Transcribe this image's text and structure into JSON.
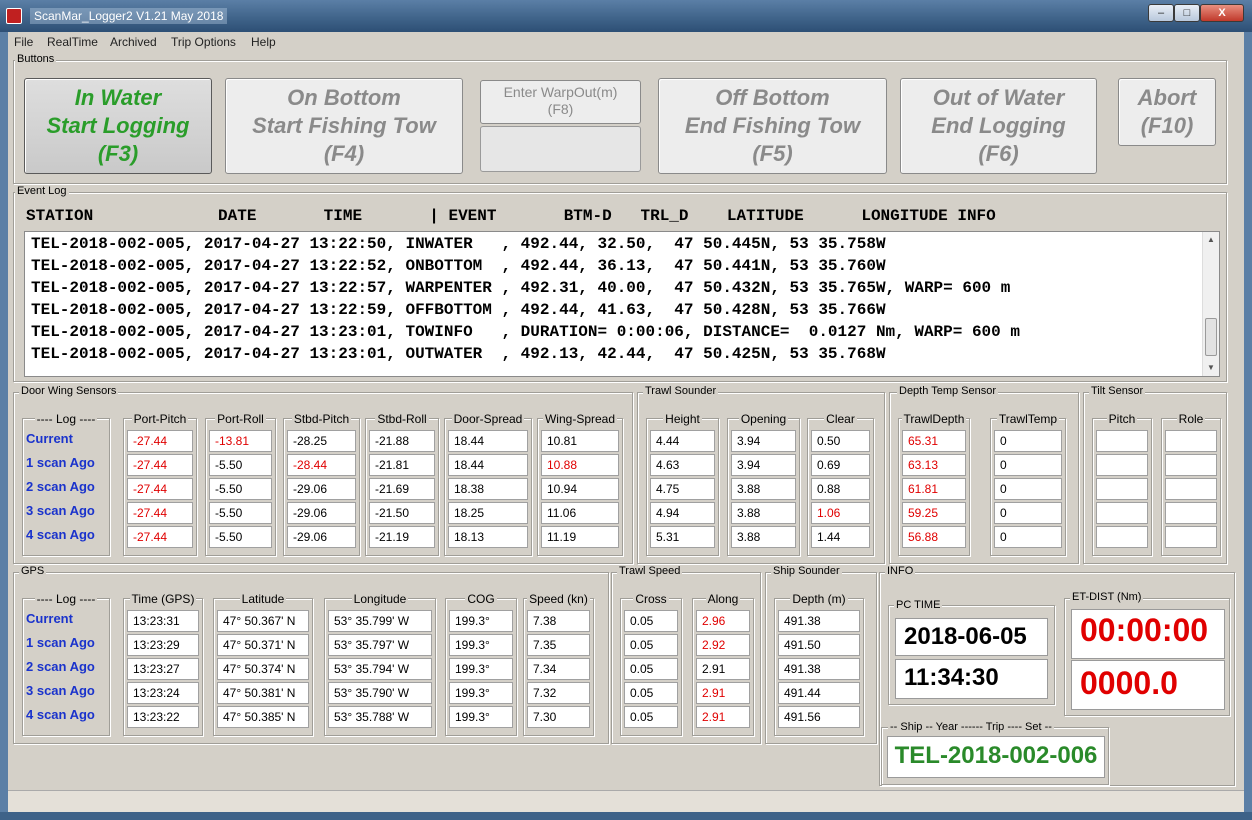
{
  "window": {
    "title": "ScanMar_Logger2 V1.21 May 2018",
    "minimize": "–",
    "maximize": "□",
    "close": "X"
  },
  "menu": [
    "File",
    "RealTime",
    "Archived",
    "Trip Options",
    "Help"
  ],
  "buttons_group": {
    "label": "Buttons",
    "in_water": [
      "In Water",
      "Start Logging",
      "(F3)"
    ],
    "on_bottom": [
      "On Bottom",
      "Start Fishing Tow",
      "(F4)"
    ],
    "warp": [
      "Enter WarpOut(m)",
      "(F8)"
    ],
    "off_bottom": [
      "Off Bottom",
      "End Fishing Tow",
      "(F5)"
    ],
    "out_of_water": [
      "Out of Water",
      "End Logging",
      "(F6)"
    ],
    "abort": [
      "Abort",
      "(F10)"
    ]
  },
  "event_log": {
    "label": "Event Log",
    "header": "STATION             DATE       TIME       | EVENT       BTM-D   TRL_D    LATITUDE      LONGITUDE INFO",
    "rows": [
      "TEL-2018-002-005, 2017-04-27 13:22:50, INWATER   , 492.44, 32.50,  47 50.445N, 53 35.758W",
      "TEL-2018-002-005, 2017-04-27 13:22:52, ONBOTTOM  , 492.44, 36.13,  47 50.441N, 53 35.760W",
      "TEL-2018-002-005, 2017-04-27 13:22:57, WARPENTER , 492.31, 40.00,  47 50.432N, 53 35.765W, WARP= 600 m",
      "TEL-2018-002-005, 2017-04-27 13:22:59, OFFBOTTOM , 492.44, 41.63,  47 50.428N, 53 35.766W",
      "TEL-2018-002-005, 2017-04-27 13:23:01, TOWINFO   , DURATION= 0:00:06, DISTANCE=  0.0127 Nm, WARP= 600 m",
      "TEL-2018-002-005, 2017-04-27 13:23:01, OUTWATER  , 492.13, 42.44,  47 50.425N, 53 35.768W"
    ]
  },
  "log_labels": {
    "header": "---- Log ----",
    "rows": [
      "Current",
      "1 scan Ago",
      "2 scan Ago",
      "3 scan Ago",
      "4 scan Ago"
    ]
  },
  "door_wing": {
    "label": "Door  Wing Sensors",
    "columns": [
      {
        "title": "Port-Pitch",
        "values": [
          "-27.44",
          "-27.44",
          "-27.44",
          "-27.44",
          "-27.44"
        ],
        "red": [
          true,
          true,
          true,
          true,
          true
        ]
      },
      {
        "title": "Port-Roll",
        "values": [
          "-13.81",
          "-5.50",
          "-5.50",
          "-5.50",
          "-5.50"
        ],
        "red": [
          true,
          false,
          false,
          false,
          false
        ]
      },
      {
        "title": "Stbd-Pitch",
        "values": [
          "-28.25",
          "-28.44",
          "-29.06",
          "-29.06",
          "-29.06"
        ],
        "red": [
          false,
          true,
          false,
          false,
          false
        ]
      },
      {
        "title": "Stbd-Roll",
        "values": [
          "-21.88",
          "-21.81",
          "-21.69",
          "-21.50",
          "-21.19"
        ],
        "red": [
          false,
          false,
          false,
          false,
          false
        ]
      },
      {
        "title": "Door-Spread",
        "values": [
          "18.44",
          "18.44",
          "18.38",
          "18.25",
          "18.13"
        ],
        "red": [
          false,
          false,
          false,
          false,
          false
        ]
      },
      {
        "title": "Wing-Spread",
        "values": [
          "10.81",
          "10.88",
          "10.94",
          "11.06",
          "11.19"
        ],
        "red": [
          false,
          true,
          false,
          false,
          false
        ]
      }
    ]
  },
  "trawl_sounder": {
    "label": "Trawl Sounder",
    "columns": [
      {
        "title": "Height",
        "values": [
          "4.44",
          "4.63",
          "4.75",
          "4.94",
          "5.31"
        ],
        "red": [
          false,
          false,
          false,
          false,
          false
        ]
      },
      {
        "title": "Opening",
        "values": [
          "3.94",
          "3.94",
          "3.88",
          "3.88",
          "3.88"
        ],
        "red": [
          false,
          false,
          false,
          false,
          false
        ]
      },
      {
        "title": "Clear",
        "values": [
          "0.50",
          "0.69",
          "0.88",
          "1.06",
          "1.44"
        ],
        "red": [
          false,
          false,
          false,
          true,
          false
        ]
      }
    ]
  },
  "depth_temp": {
    "label": "Depth Temp Sensor",
    "columns": [
      {
        "title": "TrawlDepth",
        "values": [
          "65.31",
          "63.13",
          "61.81",
          "59.25",
          "56.88"
        ],
        "red": [
          true,
          true,
          true,
          true,
          true
        ]
      },
      {
        "title": "TrawlTemp",
        "values": [
          "0",
          "0",
          "0",
          "0",
          "0"
        ],
        "red": [
          false,
          false,
          false,
          false,
          false
        ]
      }
    ]
  },
  "tilt": {
    "label": "Tilt Sensor",
    "columns": [
      {
        "title": "Pitch",
        "values": [
          "",
          "",
          "",
          "",
          ""
        ],
        "red": [
          false,
          false,
          false,
          false,
          false
        ]
      },
      {
        "title": "Role",
        "values": [
          "",
          "",
          "",
          "",
          ""
        ],
        "red": [
          false,
          false,
          false,
          false,
          false
        ]
      }
    ]
  },
  "gps": {
    "label": "GPS",
    "columns": [
      {
        "title": "Time (GPS)",
        "values": [
          "13:23:31",
          "13:23:29",
          "13:23:27",
          "13:23:24",
          "13:23:22"
        ],
        "red": [
          false,
          false,
          false,
          false,
          false
        ]
      },
      {
        "title": "Latitude",
        "values": [
          "47° 50.367' N",
          "47° 50.371' N",
          "47° 50.374' N",
          "47° 50.381' N",
          "47° 50.385' N"
        ],
        "red": [
          false,
          false,
          false,
          false,
          false
        ]
      },
      {
        "title": "Longitude",
        "values": [
          "53° 35.799' W",
          "53° 35.797' W",
          "53° 35.794' W",
          "53° 35.790' W",
          "53° 35.788' W"
        ],
        "red": [
          false,
          false,
          false,
          false,
          false
        ]
      },
      {
        "title": "COG",
        "values": [
          "199.3°",
          "199.3°",
          "199.3°",
          "199.3°",
          "199.3°"
        ],
        "red": [
          false,
          false,
          false,
          false,
          false
        ]
      },
      {
        "title": "Speed (kn)",
        "values": [
          "7.38",
          "7.35",
          "7.34",
          "7.32",
          "7.30"
        ],
        "red": [
          false,
          false,
          false,
          false,
          false
        ]
      }
    ]
  },
  "trawl_speed": {
    "label": "Trawl Speed",
    "columns": [
      {
        "title": "Cross",
        "values": [
          "0.05",
          "0.05",
          "0.05",
          "0.05",
          "0.05"
        ],
        "red": [
          false,
          false,
          false,
          false,
          false
        ]
      },
      {
        "title": "Along",
        "values": [
          "2.96",
          "2.92",
          "2.91",
          "2.91",
          "2.91"
        ],
        "red": [
          true,
          true,
          false,
          true,
          true
        ]
      }
    ]
  },
  "ship_sounder": {
    "label": "Ship Sounder",
    "columns": [
      {
        "title": "Depth (m)",
        "values": [
          "491.38",
          "491.50",
          "491.38",
          "491.44",
          "491.56"
        ],
        "red": [
          false,
          false,
          false,
          false,
          false
        ]
      }
    ]
  },
  "info": {
    "label": "INFO",
    "pc_time_label": "PC TIME",
    "date": "2018-06-05",
    "time": "11:34:30",
    "et_dist_label": "ET-DIST (Nm)",
    "elapsed": "00:00:00",
    "distance": "0000.0",
    "ship_set_label": "-- Ship -- Year ------ Trip ---- Set --",
    "ship_set": "TEL-2018-002-006"
  }
}
